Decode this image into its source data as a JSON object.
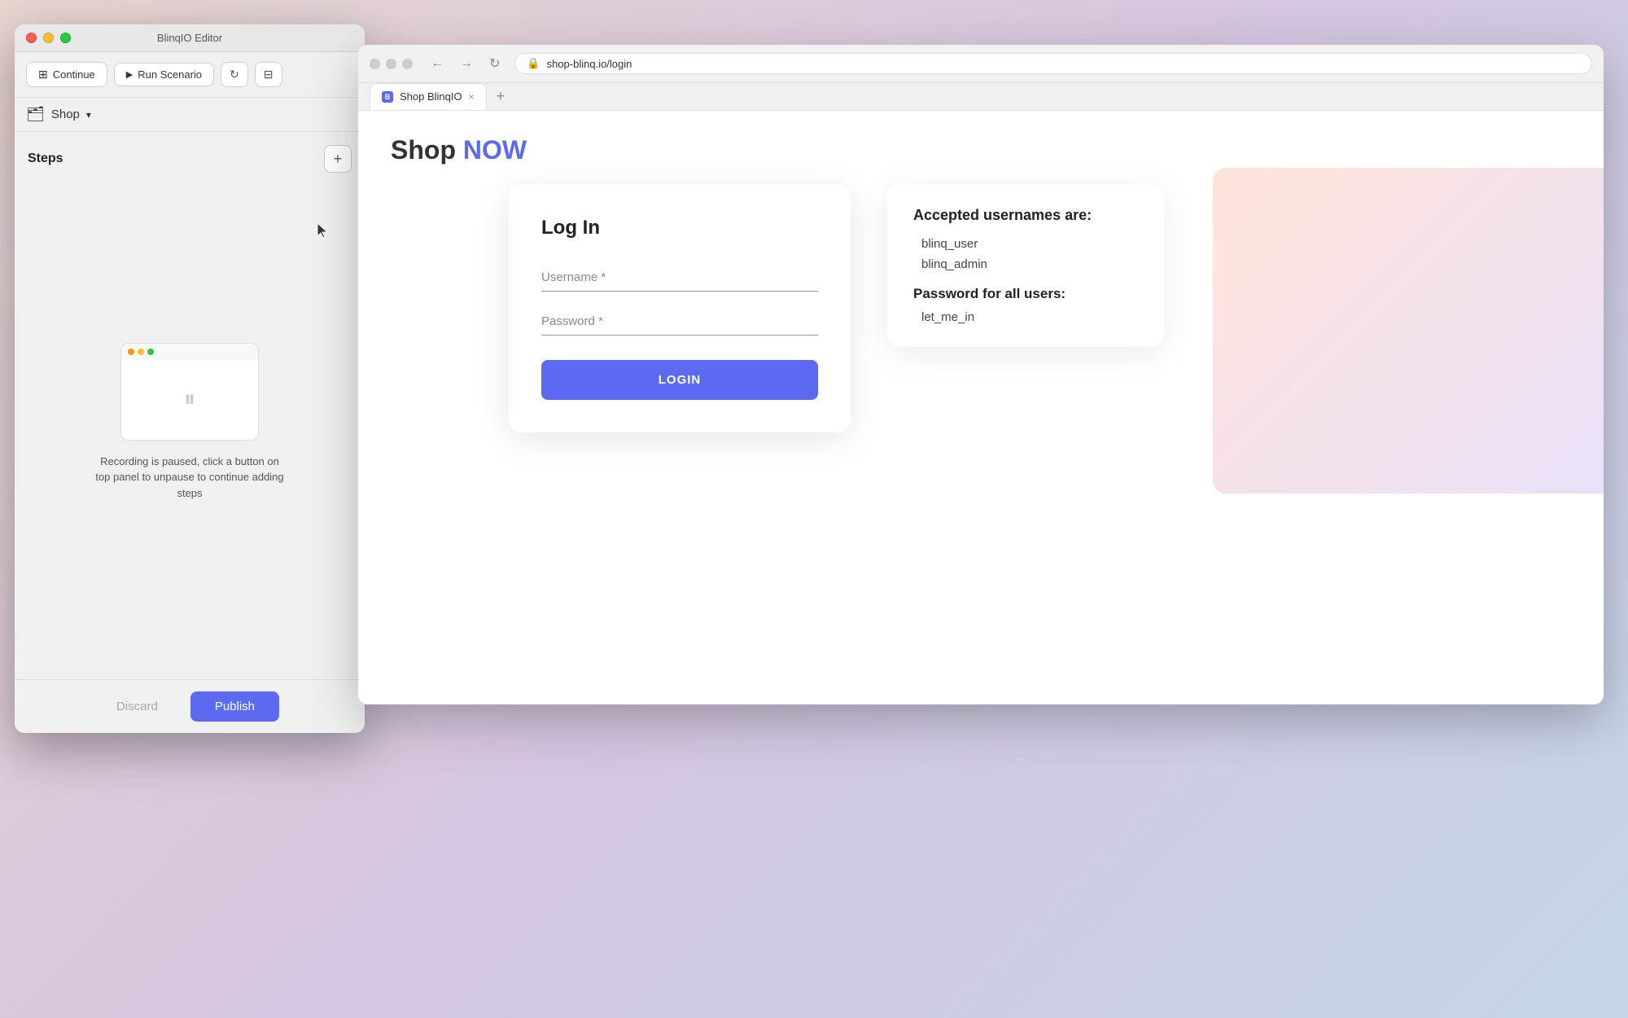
{
  "editor": {
    "title": "BlinqIO Editor",
    "buttons": {
      "continue": "Continue",
      "run_scenario": "Run Scenario",
      "discard": "Discard",
      "publish": "Publish"
    },
    "shop_label": "Shop",
    "steps_title": "Steps",
    "recording_message": "Recording is paused, click a button on top panel to unpause to continue adding steps"
  },
  "browser": {
    "tab_title": "Shop BlinqIO",
    "url": "shop-blinq.io/login",
    "shop_heading_plain": "Shop ",
    "shop_heading_highlight": "NOW"
  },
  "login_form": {
    "title": "Log In",
    "username_placeholder": "Username *",
    "password_placeholder": "Password *",
    "login_button": "LOGIN"
  },
  "info_panel": {
    "title": "Accepted usernames are:",
    "usernames": [
      "blinq_user",
      "blinq_admin"
    ],
    "password_title": "Password for all users:",
    "password": "let_me_in"
  },
  "icons": {
    "grid": "⊞",
    "play": "▶",
    "refresh": "↻",
    "layout": "⊟",
    "folder": "🗂",
    "chevron": "▾",
    "plus": "+",
    "pause": "⏸",
    "back": "←",
    "forward": "→",
    "reload": "↻",
    "lock": "🔒",
    "close": "×",
    "new_tab": "+"
  }
}
